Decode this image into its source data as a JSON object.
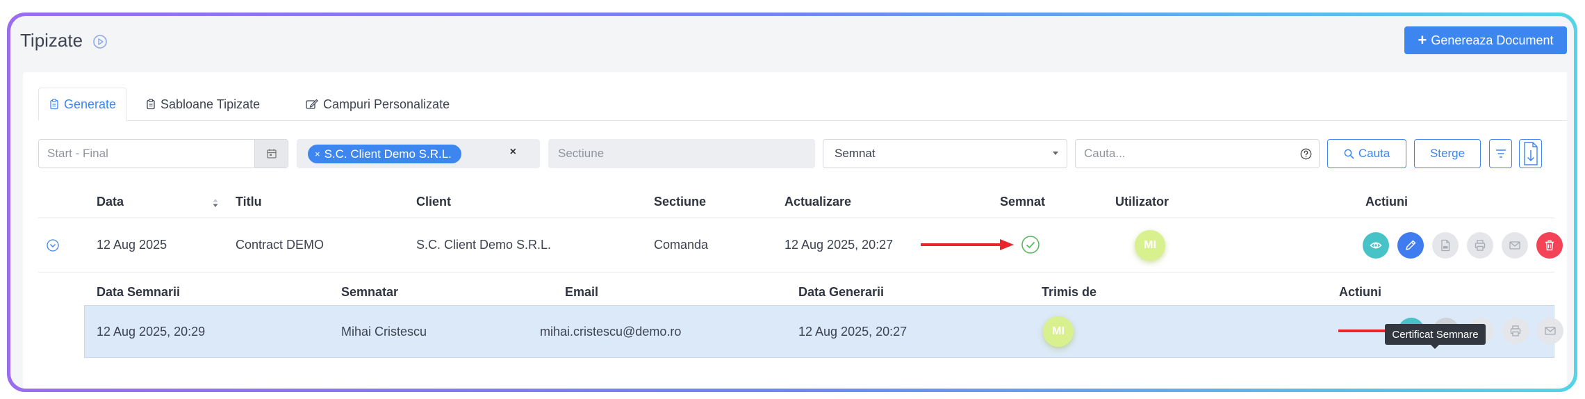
{
  "page": {
    "title": "Tipizate",
    "generate_button": "Genereaza Document"
  },
  "tabs": [
    {
      "label": "Generate",
      "active": true
    },
    {
      "label": "Sabloane Tipizate",
      "active": false
    },
    {
      "label": "Campuri Personalizate",
      "active": false
    }
  ],
  "filters": {
    "date_placeholder": "Start - Final",
    "client_chip": "S.C. Client Demo S.R.L.",
    "section_placeholder": "Sectiune",
    "signed_value": "Semnat",
    "search_placeholder": "Cauta...",
    "search_button": "Cauta",
    "clear_button": "Sterge"
  },
  "table": {
    "headers": {
      "data": "Data",
      "titlu": "Titlu",
      "client": "Client",
      "sectiune": "Sectiune",
      "actualizare": "Actualizare",
      "semnat": "Semnat",
      "utilizator": "Utilizator",
      "actiuni": "Actiuni"
    },
    "row": {
      "data": "12 Aug 2025",
      "titlu": "Contract DEMO",
      "client": "S.C. Client Demo S.R.L.",
      "sectiune": "Comanda",
      "actualizare": "12 Aug 2025, 20:27",
      "utilizator_initials": "MI"
    }
  },
  "subtable": {
    "headers": {
      "data_semnarii": "Data Semnarii",
      "semnatar": "Semnatar",
      "email": "Email",
      "data_generarii": "Data Generarii",
      "trimis_de": "Trimis de",
      "actiuni": "Actiuni"
    },
    "row": {
      "data_semnarii": "12 Aug 2025, 20:29",
      "semnatar": "Mihai Cristescu",
      "email": "mihai.cristescu@demo.ro",
      "data_generarii": "12 Aug 2025, 20:27",
      "trimis_de_initials": "MI"
    }
  },
  "tooltip": "Certificat Semnare",
  "colors": {
    "accent": "#3e86ef",
    "teal": "#47c2c7",
    "danger": "#f44356",
    "success": "#5cb85c",
    "arrow": "#e8262b",
    "avatar": "#d9f08e"
  }
}
